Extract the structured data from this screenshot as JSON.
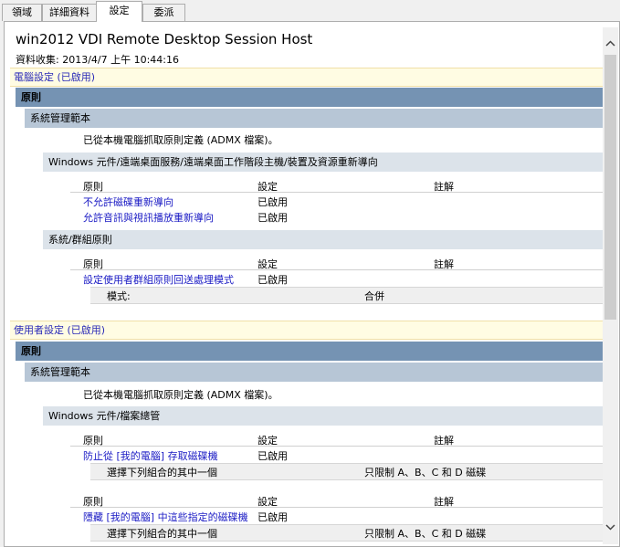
{
  "tabs": [
    {
      "label": "領域"
    },
    {
      "label": "詳細資料"
    },
    {
      "label": "設定"
    },
    {
      "label": "委派"
    }
  ],
  "report": {
    "title": "win2012 VDI Remote Desktop Session Host",
    "collected": "資料收集: 2013/4/7 上午 10:44:16",
    "computer": {
      "header": "電腦設定 (已啟用)",
      "policies_bar": "原則",
      "admin_templates": "系統管理範本",
      "admx_note": "已從本機電腦抓取原則定義 (ADMX 檔案)。",
      "group1": {
        "title": "Windows 元件/遠端桌面服務/遠端桌面工作階段主機/裝置及資源重新導向",
        "col_policy": "原則",
        "col_setting": "設定",
        "col_comment": "註解",
        "rows": [
          {
            "name": "不允許磁碟重新導向",
            "value": "已啟用"
          },
          {
            "name": "允許音訊與視訊播放重新導向",
            "value": "已啟用"
          }
        ]
      },
      "group2": {
        "title": "系統/群組原則",
        "col_policy": "原則",
        "col_setting": "設定",
        "col_comment": "註解",
        "rows": [
          {
            "name": "設定使用者群組原則回送處理模式",
            "value": "已啟用"
          }
        ],
        "sub": {
          "label": "模式:",
          "value": "合併"
        }
      }
    },
    "user": {
      "header": "使用者設定 (已啟用)",
      "policies_bar": "原則",
      "admin_templates": "系統管理範本",
      "admx_note": "已從本機電腦抓取原則定義 (ADMX 檔案)。",
      "group1": {
        "title": "Windows 元件/檔案總管",
        "block1": {
          "col_policy": "原則",
          "col_setting": "設定",
          "col_comment": "註解",
          "name": "防止從 [我的電腦] 存取磁碟機",
          "value": "已啟用",
          "sub_label": "選擇下列組合的其中一個",
          "sub_value": "只限制 A、B、C 和 D 磁碟"
        },
        "block2": {
          "col_policy": "原則",
          "col_setting": "設定",
          "col_comment": "註解",
          "name": "隱藏 [我的電腦] 中這些指定的磁碟機",
          "value": "已啟用",
          "sub_label": "選擇下列組合的其中一個",
          "sub_value": "只限制 A、B、C 和 D 磁碟"
        }
      }
    }
  },
  "icons": {
    "scroll_up": "chevron-up-icon",
    "scroll_down": "chevron-down-icon"
  }
}
